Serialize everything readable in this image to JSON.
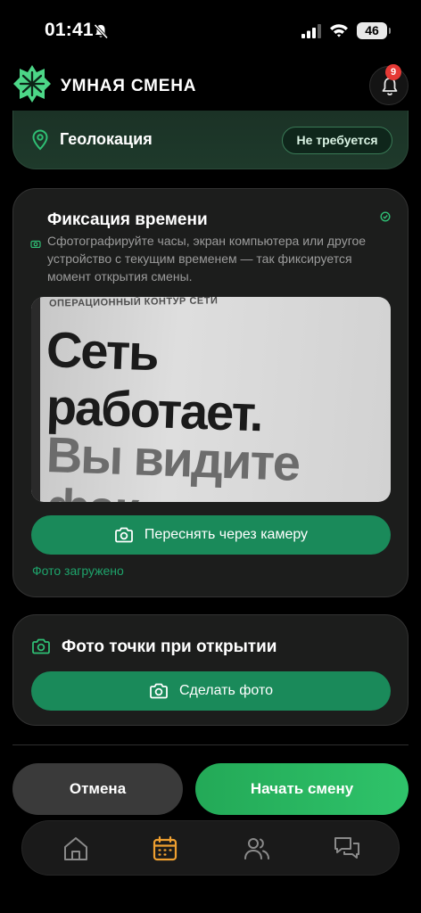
{
  "status_bar": {
    "time": "01:41",
    "battery": "46"
  },
  "header": {
    "title": "УМНАЯ СМЕНА",
    "notifications_count": "9"
  },
  "geolocation": {
    "label": "Геолокация",
    "status": "Не требуется"
  },
  "time_fix": {
    "title": "Фиксация времени",
    "description": "Сфотографируйте часы, экран компьютера или другое устройство с текущим временем — так фиксируется момент открытия смены.",
    "photo_text": {
      "small": "ОПЕРАЦИОННЫЙ КОНТУР СЕТИ",
      "line1": "Сеть",
      "line2": "работает.",
      "line3": "Вы видите",
      "line4": "фак"
    },
    "retake_label": "Переснять через камеру",
    "uploaded_text": "Фото загружено"
  },
  "opening_photo": {
    "title": "Фото точки при открытии",
    "take_label": "Сделать фото"
  },
  "actions": {
    "cancel": "Отмена",
    "start": "Начать смену"
  },
  "tabbar": {
    "items": [
      "home-icon",
      "calendar-icon",
      "users-icon",
      "chat-icon"
    ],
    "active": "calendar-icon"
  },
  "colors": {
    "accent": "#1a8a5a",
    "start_button": "#2fc36a",
    "active_tab": "#f0a030",
    "badge": "#e53935"
  }
}
